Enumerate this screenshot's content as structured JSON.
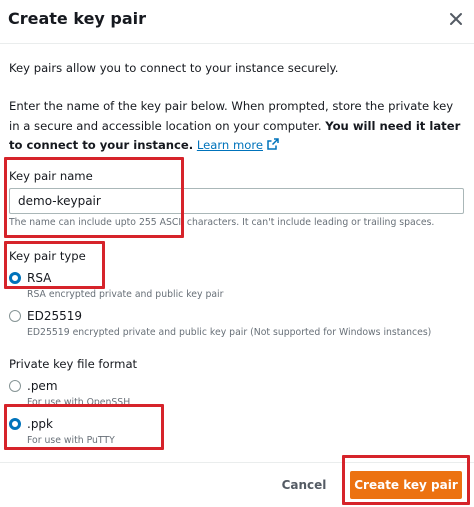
{
  "dialog": {
    "title": "Create key pair",
    "intro_line1": "Key pairs allow you to connect to your instance securely.",
    "intro_line2": "Enter the name of the key pair below. When prompted, store the private key in a secure and accessible location on your computer.",
    "intro_bold": "You will need it later to connect to your instance.",
    "learn_more": "Learn more"
  },
  "key_name": {
    "label": "Key pair name",
    "value": "demo-keypair",
    "hint": "The name can include upto 255 ASCII characters. It can't include leading or trailing spaces."
  },
  "key_type": {
    "label": "Key pair type",
    "options": [
      {
        "label": "RSA",
        "description": "RSA encrypted private and public key pair",
        "selected": true
      },
      {
        "label": "ED25519",
        "description": "ED25519 encrypted private and public key pair (Not supported for Windows instances)",
        "selected": false
      }
    ]
  },
  "file_format": {
    "label": "Private key file format",
    "options": [
      {
        "label": ".pem",
        "description": "For use with OpenSSH",
        "selected": false
      },
      {
        "label": ".ppk",
        "description": "For use with PuTTY",
        "selected": true
      }
    ]
  },
  "footer": {
    "cancel_label": "Cancel",
    "create_label": "Create key pair"
  },
  "colors": {
    "primary_button": "#ec7211",
    "link": "#0073bb",
    "highlight_box": "#d6232a",
    "radio_selected": "#0073bb"
  },
  "icons": {
    "close": "close-icon",
    "external_link": "external-link-icon"
  }
}
